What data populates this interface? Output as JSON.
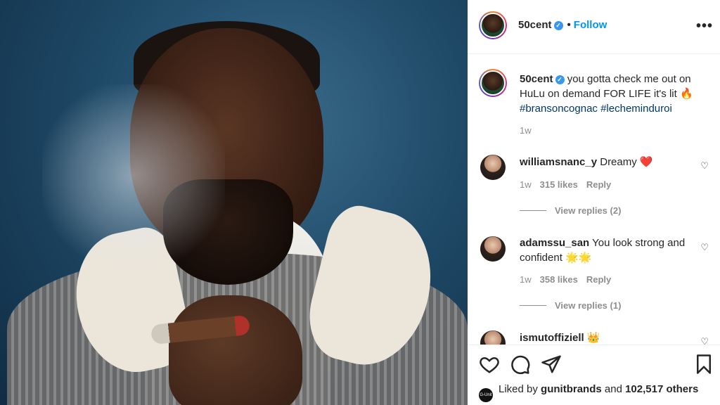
{
  "post": {
    "author": "50cent",
    "follow_separator": "•",
    "follow_label": "Follow",
    "more_label": "•••",
    "verified_mark": "✓"
  },
  "caption": {
    "author": "50cent",
    "text": "you gotta check me out on HuLu on demand FOR LIFE it's lit 🔥",
    "hashtags": [
      "#bransoncognac",
      "#lecheminduroi"
    ],
    "time": "1w"
  },
  "comments": [
    {
      "username": "williamsnanc_y",
      "text": "Dreamy ❤️",
      "time": "1w",
      "likes": "315 likes",
      "reply": "Reply",
      "view_replies": "View replies (2)"
    },
    {
      "username": "adamssu_san",
      "text": "You look strong and confident 🌟🌟",
      "time": "1w",
      "likes": "358 likes",
      "reply": "Reply",
      "view_replies": "View replies (1)"
    },
    {
      "username": "ismutoffiziell",
      "text": "👑"
    }
  ],
  "likes": {
    "prefix": "Liked by",
    "user": "gunitbrands",
    "and": "and",
    "count": "102,517 others",
    "avatar_text": "G-Unit"
  },
  "icons": [
    "heart-icon",
    "comment-icon",
    "share-icon",
    "bookmark-icon",
    "ellipsis-icon",
    "verified-icon"
  ],
  "colors": {
    "accent": "#0095f6",
    "hashtag": "#00376b",
    "muted": "#8e8e8e",
    "verified": "#3897f0"
  }
}
